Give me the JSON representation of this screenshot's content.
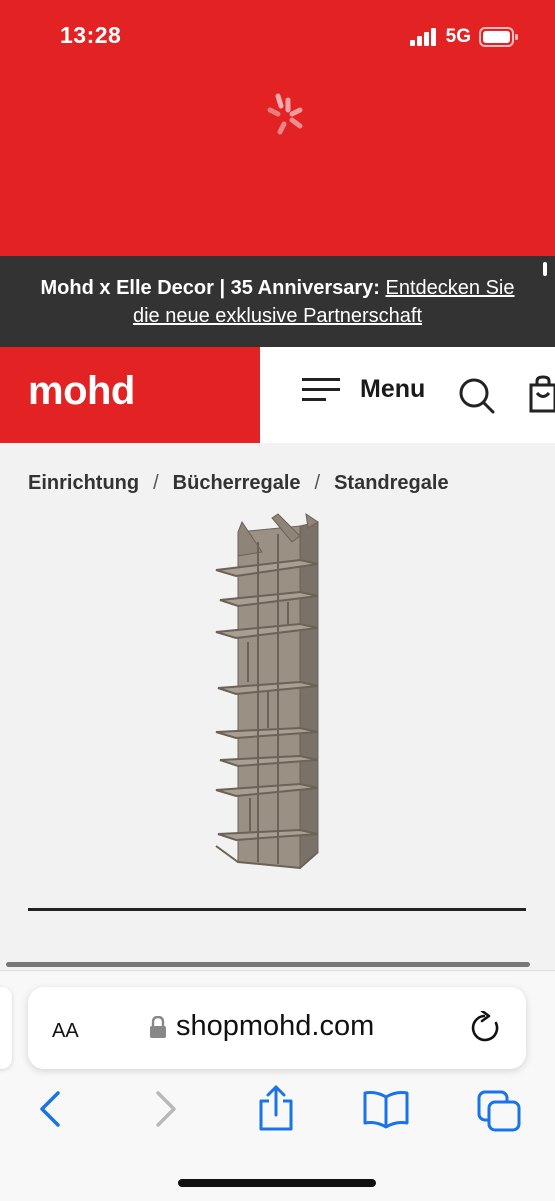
{
  "status_bar": {
    "time": "13:28",
    "network": "5G"
  },
  "announcement": {
    "text": "Mohd x Elle Decor | 35 Anniversary:",
    "link": "Entdecken Sie die neue exklusive Partnerschaft"
  },
  "header": {
    "logo": "mohd",
    "menu_label": "Menu"
  },
  "breadcrumb": {
    "items": [
      "Einrichtung",
      "Bücherregale",
      "Standregale"
    ],
    "separator": "/"
  },
  "browser": {
    "text_size_label": "AA",
    "url": "shopmohd.com"
  },
  "colors": {
    "brand_red": "#e32323",
    "announcement_bg": "#333333",
    "ios_blue": "#1a73e8"
  }
}
